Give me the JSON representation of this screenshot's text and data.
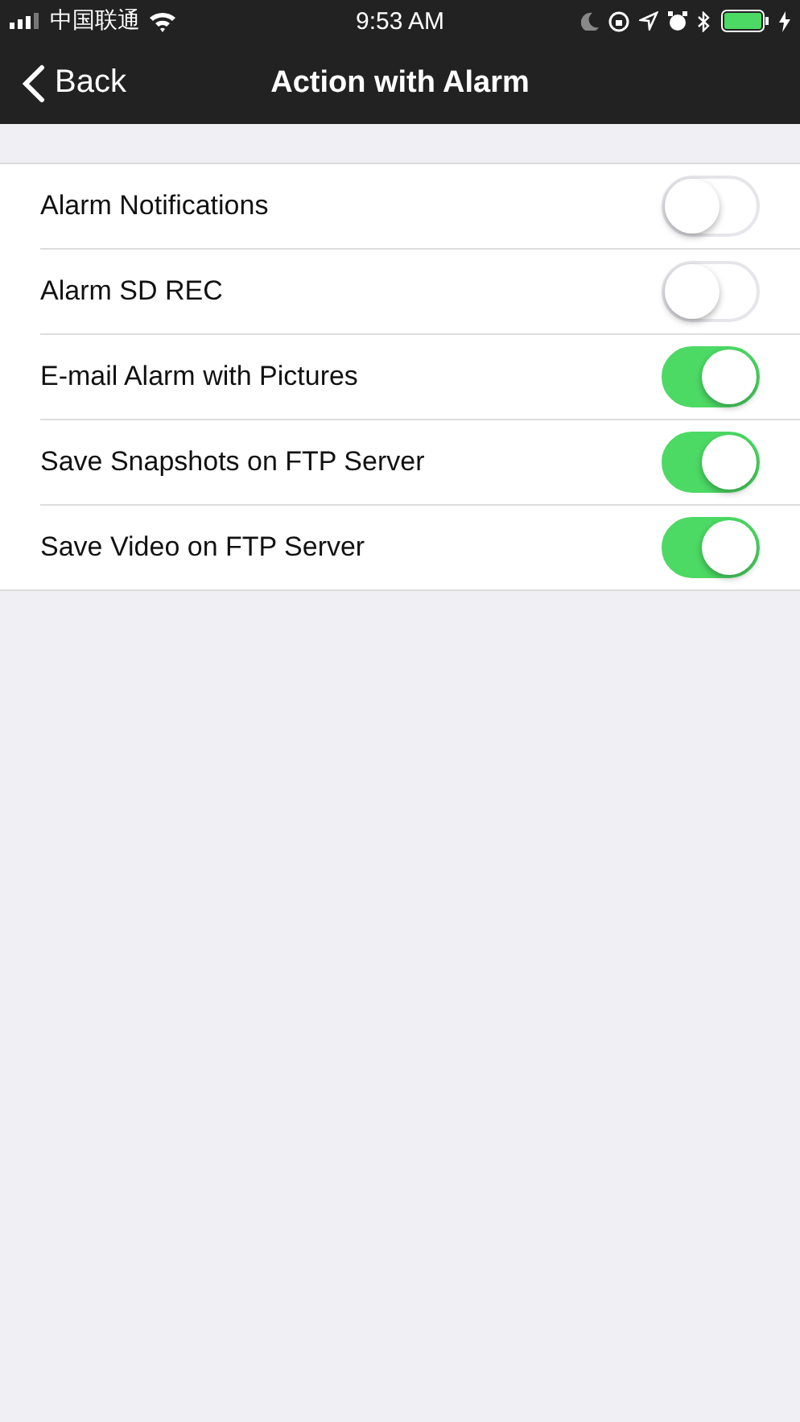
{
  "status_bar": {
    "carrier": "中国联通",
    "time": "9:53 AM"
  },
  "nav": {
    "back": "Back",
    "title": "Action with Alarm"
  },
  "settings": [
    {
      "label": "Alarm Notifications",
      "on": false
    },
    {
      "label": "Alarm SD REC",
      "on": false
    },
    {
      "label": "E-mail Alarm with Pictures",
      "on": true
    },
    {
      "label": "Save Snapshots on FTP Server",
      "on": true
    },
    {
      "label": "Save Video on FTP Server",
      "on": true
    }
  ]
}
